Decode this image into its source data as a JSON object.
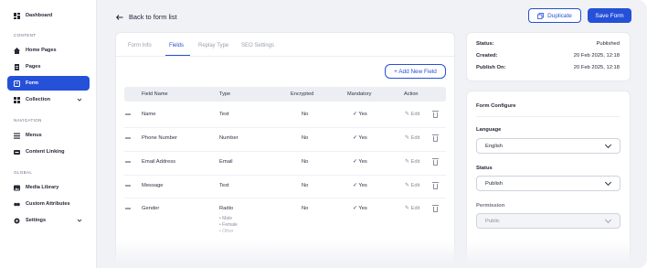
{
  "sidebar": {
    "dashboard": "Dashboard",
    "section_content": "CONTENT",
    "home_pages": "Home Pages",
    "pages": "Pages",
    "form": "Form",
    "collection": "Collection",
    "section_navigation": "NAVIGATION",
    "menus": "Menus",
    "content_linking": "Content Linking",
    "section_global": "GLOBAL",
    "media_library": "Media Library",
    "custom_attributes": "Custom Attributes",
    "settings": "Settings"
  },
  "header": {
    "back_label": "Back to form list",
    "duplicate_label": "Duplicate",
    "save_label": "Save Form"
  },
  "tabs": [
    "Form Info",
    "Fields",
    "Replay Type",
    "SEO Settings"
  ],
  "active_tab": "Fields",
  "add_field_label": "+ Add New Field",
  "table": {
    "columns": [
      "Field Name",
      "Type",
      "Encrypted",
      "Mandatory",
      "Action"
    ],
    "rows": [
      {
        "name": "Name",
        "type": "Text",
        "encrypted": "No",
        "mandatory": "Yes"
      },
      {
        "name": "Phone Number",
        "type": "Number",
        "encrypted": "No",
        "mandatory": "Yes"
      },
      {
        "name": "Email Address",
        "type": "Email",
        "encrypted": "No",
        "mandatory": "Yes"
      },
      {
        "name": "Message",
        "type": "Text",
        "encrypted": "No",
        "mandatory": "Yes"
      },
      {
        "name": "Gender",
        "type": "Radio",
        "encrypted": "No",
        "mandatory": "Yes",
        "options": [
          "Male",
          "Female",
          "Other"
        ]
      }
    ],
    "edit_label": "Edit"
  },
  "status_card": {
    "status_label": "Status:",
    "status_value": "Published",
    "created_label": "Created:",
    "created_value": "20 Feb 2025, 12:18",
    "publish_label": "Publish On:",
    "publish_value": "20 Feb 2025, 12:18"
  },
  "configure": {
    "title": "Form Configure",
    "language_label": "Language",
    "language_value": "English",
    "status_label": "Status",
    "status_value": "Publish",
    "permission_label": "Permission",
    "permission_value": "Public"
  },
  "colors": {
    "accent": "#2550d8",
    "background": "#f1f2f6"
  }
}
